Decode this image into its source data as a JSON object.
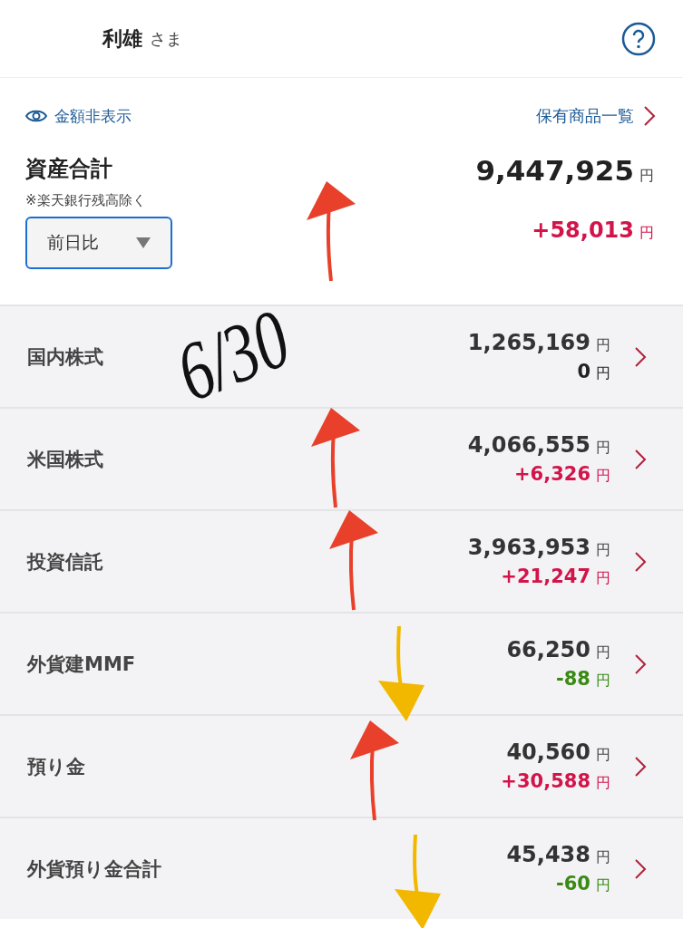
{
  "header": {
    "name": "利雄",
    "honorific": "さま"
  },
  "summary": {
    "hide_label": "金額非表示",
    "holdings_link": "保有商品一覧",
    "title": "資産合計",
    "note": "※楽天銀行残高除く",
    "compare_select": "前日比",
    "total": "9,447,925",
    "total_unit": "円",
    "change": "+58,013",
    "change_unit": "円",
    "color": "#d3144a"
  },
  "rows": [
    {
      "label": "国内株式",
      "amount": "1,265,169",
      "amount_unit": "円",
      "change": "0",
      "change_unit": "円",
      "color": "#222222"
    },
    {
      "label": "米国株式",
      "amount": "4,066,555",
      "amount_unit": "円",
      "change": "+6,326",
      "change_unit": "円",
      "color": "#d3144a"
    },
    {
      "label": "投資信託",
      "amount": "3,963,953",
      "amount_unit": "円",
      "change": "+21,247",
      "change_unit": "円",
      "color": "#d3144a"
    },
    {
      "label": "外貨建MMF",
      "amount": "66,250",
      "amount_unit": "円",
      "change": "-88",
      "change_unit": "円",
      "color": "#3a8a14"
    },
    {
      "label": "預り金",
      "amount": "40,560",
      "amount_unit": "円",
      "change": "+30,588",
      "change_unit": "円",
      "color": "#d3144a"
    },
    {
      "label": "外貨預り金合計",
      "amount": "45,438",
      "amount_unit": "円",
      "change": "-60",
      "change_unit": "円",
      "color": "#3a8a14"
    }
  ],
  "annotation": {
    "text": "6/30"
  },
  "arrows": [
    {
      "kind": "up",
      "color": "#e8402a"
    },
    {
      "kind": "up",
      "color": "#e8402a"
    },
    {
      "kind": "up",
      "color": "#e8402a"
    },
    {
      "kind": "down",
      "color": "#f2b800"
    },
    {
      "kind": "up",
      "color": "#e8402a"
    },
    {
      "kind": "down",
      "color": "#f2b800"
    }
  ]
}
